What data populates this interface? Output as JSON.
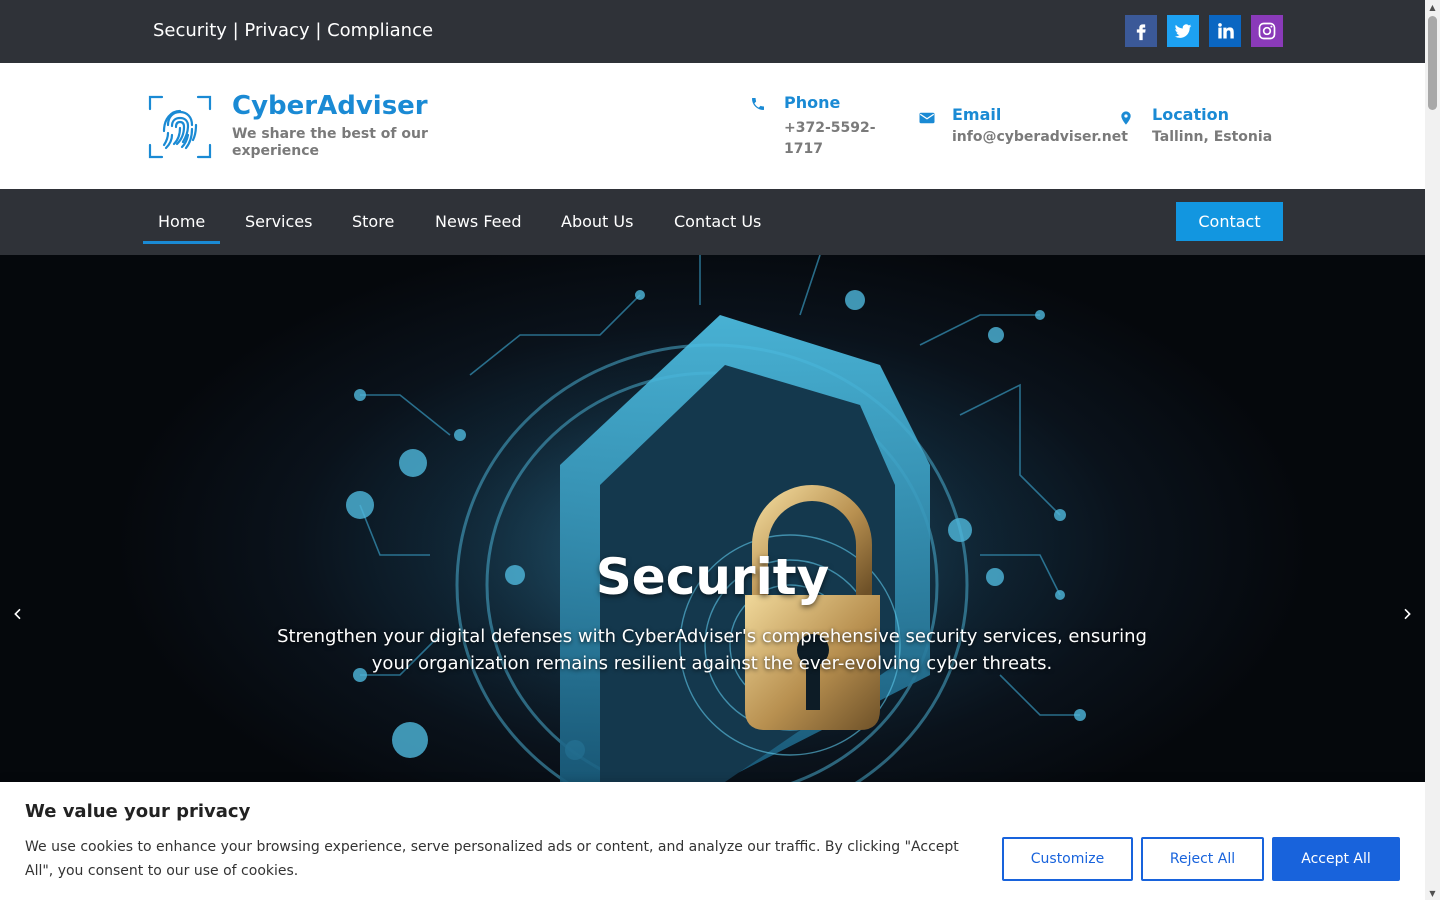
{
  "topbar": {
    "tagline": "Security | Privacy | Compliance",
    "socials": [
      {
        "icon": "facebook-icon",
        "color": "#3b5998"
      },
      {
        "icon": "twitter-icon",
        "color": "#1da1f2"
      },
      {
        "icon": "linkedin-icon",
        "color": "#0a66c2"
      },
      {
        "icon": "instagram-icon",
        "color": "#8a3ab9"
      }
    ]
  },
  "header": {
    "brand_name": "CyberAdviser",
    "brand_sub": "We share the best of our experience",
    "phone": {
      "title": "Phone",
      "value": "+372-5592-1717",
      "icon": "phone-icon"
    },
    "email": {
      "title": "Email",
      "value": "info@cyberadviser.net",
      "icon": "email-icon"
    },
    "location": {
      "title": "Location",
      "value": "Tallinn, Estonia",
      "icon": "location-pin-icon"
    }
  },
  "nav": {
    "items": [
      {
        "label": "Home",
        "active": true
      },
      {
        "label": "Services"
      },
      {
        "label": "Store"
      },
      {
        "label": "News Feed"
      },
      {
        "label": "About Us"
      },
      {
        "label": "Contact Us"
      }
    ],
    "cta_label": "Contact"
  },
  "hero": {
    "title": "Security",
    "text": "Strengthen your digital defenses with CyberAdviser's comprehensive security services, ensuring your organization remains resilient against the ever-evolving cyber threats.",
    "prev_icon": "chevron-left-icon",
    "next_icon": "chevron-right-icon"
  },
  "cookie": {
    "title": "We value your privacy",
    "text": "We use cookies to enhance your browsing experience, serve personalized ads or content, and analyze our traffic. By clicking \"Accept All\", you consent to our use of cookies.",
    "customize_label": "Customize",
    "reject_label": "Reject All",
    "accept_label": "Accept All"
  },
  "colors": {
    "accent": "#1a8ad4",
    "dark_bar": "#2f3238",
    "cookie_button": "#1863dc"
  }
}
